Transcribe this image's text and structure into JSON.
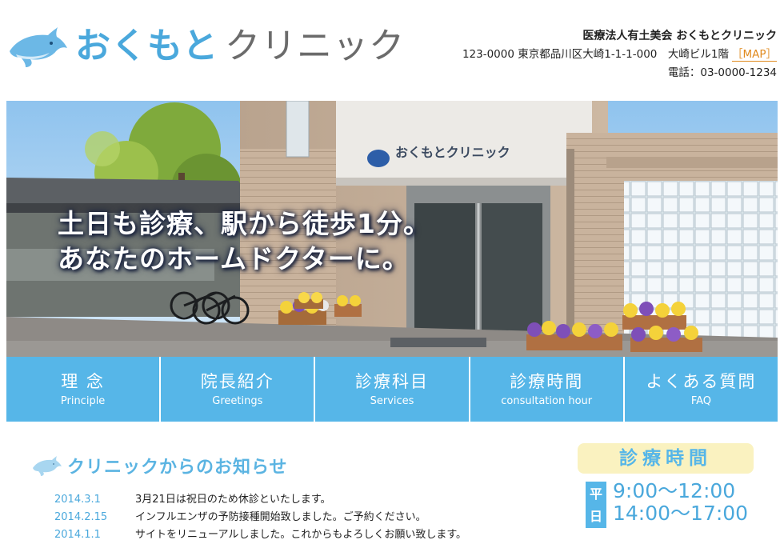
{
  "header": {
    "logo_blue": "おくもと",
    "logo_gray": "クリニック",
    "org_name": "医療法人有土美会 おくもとクリニック",
    "address": "123-0000 東京都品川区大崎1-1-1-000　大崎ビル1階",
    "map_link": "［MAP］",
    "phone": "電話：03-0000-1234"
  },
  "hero": {
    "line1": "土日も診療、駅から徒歩1分。",
    "line2": "あなたのホームドクターに。",
    "sign_text": "おくもとクリニック"
  },
  "nav": {
    "items": [
      {
        "ja": "理 念",
        "en": "Principle"
      },
      {
        "ja": "院長紹介",
        "en": "Greetings"
      },
      {
        "ja": "診療科目",
        "en": "Services"
      },
      {
        "ja": "診療時間",
        "en": "consultation hour"
      },
      {
        "ja": "よくある質問",
        "en": "FAQ"
      }
    ]
  },
  "news": {
    "title": "クリニックからのお知らせ",
    "items": [
      {
        "date": "2014.3.1",
        "text": "3月21日は祝日のため休診といたします。"
      },
      {
        "date": "2014.2.15",
        "text": "インフルエンザの予防接種開始致しました。ご予約ください。"
      },
      {
        "date": "2014.1.1",
        "text": "サイトをリニューアルしました。これからもよろしくお願い致します。"
      }
    ]
  },
  "hours": {
    "title": "診療時間",
    "day_tag": "平日",
    "time1": "9:00～12:00",
    "time2": "14:00～17:00"
  },
  "colors": {
    "accent": "#56b6e8",
    "logo_blue": "#4aa8dc",
    "map_orange": "#e08a1e",
    "hours_bg": "#faf2c0"
  }
}
